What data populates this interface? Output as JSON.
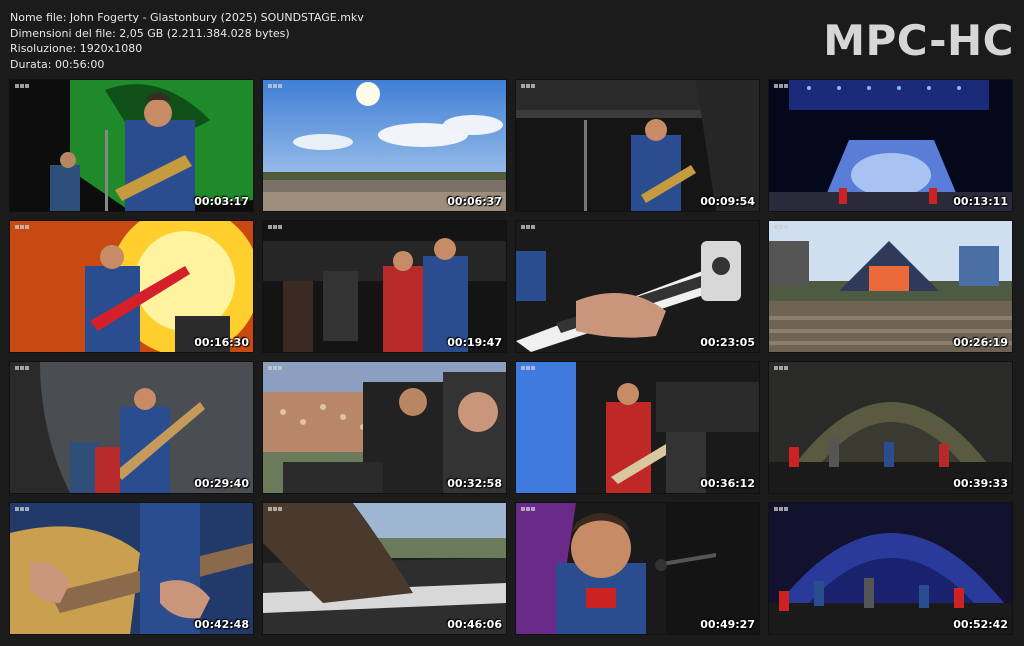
{
  "info": {
    "file_name": "Nome file: John Fogerty - Glastonbury (2025) SOUNDSTAGE.mkv",
    "file_size": "Dimensioni del file: 2,05 GB (2.211.384.028 bytes)",
    "resolution": "Risoluzione: 1920x1080",
    "duration": "Durata: 00:56:00"
  },
  "brand": "MPC-HC",
  "thumbnails": [
    {
      "time": "00:03:17",
      "scene": "performer-green-stage"
    },
    {
      "time": "00:06:37",
      "scene": "sky-festival-view"
    },
    {
      "time": "00:09:54",
      "scene": "performer-side-stage"
    },
    {
      "time": "00:13:11",
      "scene": "pyramid-stage-night"
    },
    {
      "time": "00:16:30",
      "scene": "performer-orange-backdrop"
    },
    {
      "time": "00:19:47",
      "scene": "band-on-stage"
    },
    {
      "time": "00:23:05",
      "scene": "guitar-closeup"
    },
    {
      "time": "00:26:19",
      "scene": "pyramid-stage-crowd"
    },
    {
      "time": "00:29:40",
      "scene": "acoustic-performance"
    },
    {
      "time": "00:32:58",
      "scene": "keyboard-player-crowd"
    },
    {
      "time": "00:36:12",
      "scene": "guitarist-red-shirt"
    },
    {
      "time": "00:39:33",
      "scene": "wide-stage-band"
    },
    {
      "time": "00:42:48",
      "scene": "gold-guitar-closeup"
    },
    {
      "time": "00:46:06",
      "scene": "keyboard-closeup"
    },
    {
      "time": "00:49:27",
      "scene": "singer-closeup"
    },
    {
      "time": "00:52:42",
      "scene": "wide-stage-blue"
    }
  ]
}
